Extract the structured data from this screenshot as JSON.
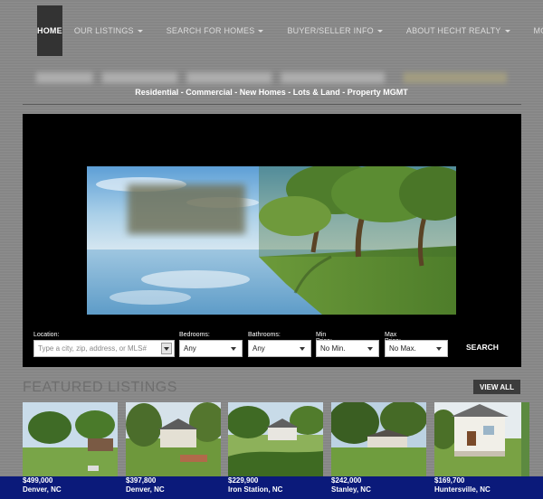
{
  "nav": {
    "items": [
      {
        "label": "HOME",
        "active": true,
        "dropdown": false
      },
      {
        "label": "OUR LISTINGS",
        "dropdown": true
      },
      {
        "label": "SEARCH FOR HOMES",
        "dropdown": true
      },
      {
        "label": "BUYER/SELLER INFO",
        "dropdown": true
      },
      {
        "label": "ABOUT HECHT REALTY",
        "dropdown": true
      },
      {
        "label": "MORE",
        "dropdown": true
      }
    ]
  },
  "tagline": "Residential - Commercial - New Homes - Lots & Land - Property MGMT",
  "search": {
    "location_label": "Location:",
    "location_placeholder": "Type a city, zip, address, or MLS#",
    "bedrooms_label": "Bedrooms:",
    "bedrooms_value": "Any",
    "bathrooms_label": "Bathrooms:",
    "bathrooms_value": "Any",
    "min_price_label": "Min Price:",
    "min_price_value": "No Min.",
    "max_price_label": "Max Price:",
    "max_price_value": "No Max.",
    "button_label": "SEARCH"
  },
  "featured": {
    "title": "FEATURED LISTINGS",
    "view_all_label": "VIEW ALL",
    "listings": [
      {
        "price": "$499,000",
        "location": "Denver, NC"
      },
      {
        "price": "$397,800",
        "location": "Denver, NC"
      },
      {
        "price": "$229,900",
        "location": "Iron Station, NC"
      },
      {
        "price": "$242,000",
        "location": "Stanley, NC"
      },
      {
        "price": "$169,700",
        "location": "Huntersville, NC"
      }
    ]
  },
  "colors": {
    "nav_active_bg": "#333333",
    "caption_band": "#0b1a7a",
    "hero_bg": "#000000"
  }
}
